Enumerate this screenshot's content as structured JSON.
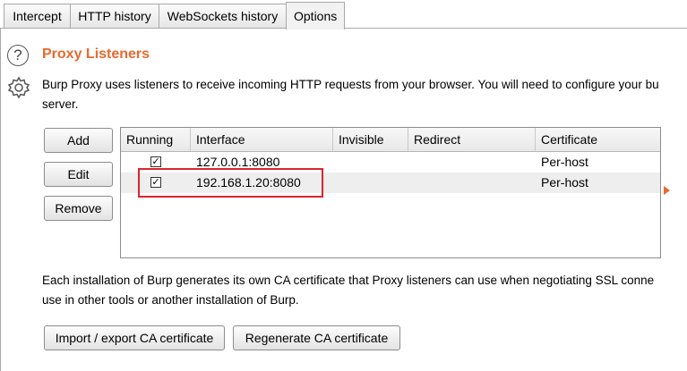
{
  "tabs": [
    {
      "label": "Intercept"
    },
    {
      "label": "HTTP history"
    },
    {
      "label": "WebSockets history"
    },
    {
      "label": "Options"
    }
  ],
  "section": {
    "title": "Proxy Listeners",
    "description_line1": "Burp Proxy uses listeners to receive incoming HTTP requests from your browser. You will need to configure your bu",
    "description_line2": "server."
  },
  "buttons": {
    "add": "Add",
    "edit": "Edit",
    "remove": "Remove",
    "import_export": "Import / export CA certificate",
    "regenerate": "Regenerate CA certificate"
  },
  "table": {
    "columns": [
      "Running",
      "Interface",
      "Invisible",
      "Redirect",
      "Certificate"
    ],
    "rows": [
      {
        "running": true,
        "interface": "127.0.0.1:8080",
        "invisible": "",
        "redirect": "",
        "certificate": "Per-host"
      },
      {
        "running": true,
        "interface": "192.168.1.20:8080",
        "invisible": "",
        "redirect": "",
        "certificate": "Per-host"
      }
    ]
  },
  "ca_text": {
    "line1": "Each installation of Burp generates its own CA certificate that Proxy listeners can use when negotiating SSL conne",
    "line2": "use in other tools or another installation of Burp."
  },
  "colors": {
    "title": "#e8692e",
    "highlight": "#d9262b"
  }
}
